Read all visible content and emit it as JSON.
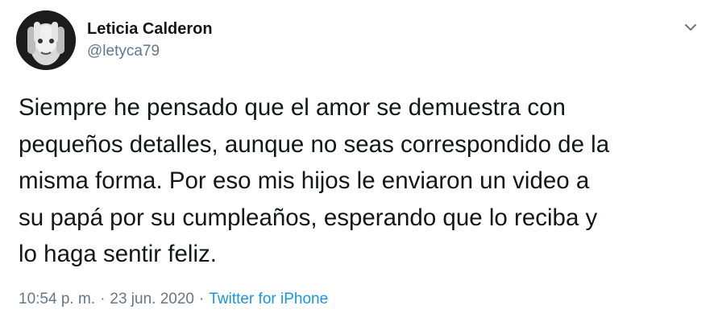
{
  "user": {
    "display_name": "Leticia Calderon",
    "handle": "@letyca79"
  },
  "tweet": {
    "text": "Siempre he pensado que el amor se demuestra con\npequeños detalles, aunque no seas correspondido de la\nmisma forma. Por eso mis hijos le enviaron un video a\nsu papá por su cumpleaños, esperando que lo reciba y\nlo haga sentir feliz.",
    "time": "10:54 p. m.",
    "date": "23 jun. 2020",
    "separator": "·",
    "source": "Twitter for iPhone"
  },
  "icons": {
    "caret": "chevron-down-icon",
    "avatar": "avatar"
  },
  "colors": {
    "text": "#14171a",
    "secondary": "#657786",
    "link": "#1b95e0",
    "background": "#ffffff"
  }
}
